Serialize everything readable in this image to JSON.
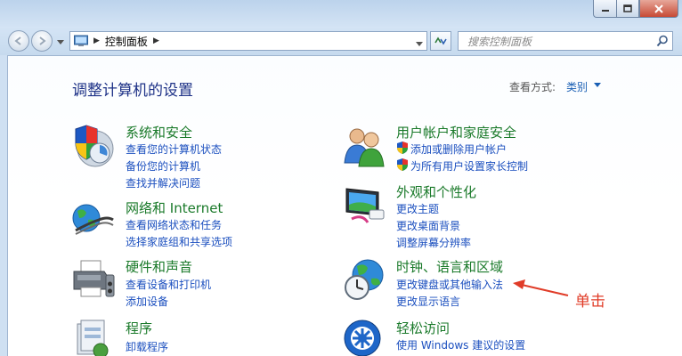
{
  "address_bar": {
    "path": "控制面板"
  },
  "search": {
    "placeholder": "搜索控制面板"
  },
  "main": {
    "heading": "调整计算机的设置",
    "view_by_label": "查看方式:",
    "view_by_value": "类别"
  },
  "categories": {
    "system_security": {
      "title": "系统和安全",
      "links": [
        "查看您的计算机状态",
        "备份您的计算机",
        "查找并解决问题"
      ]
    },
    "user_accounts": {
      "title": "用户帐户和家庭安全",
      "links": [
        "添加或删除用户帐户",
        "为所有用户设置家长控制"
      ]
    },
    "network": {
      "title": "网络和 Internet",
      "links": [
        "查看网络状态和任务",
        "选择家庭组和共享选项"
      ]
    },
    "appearance": {
      "title": "外观和个性化",
      "links": [
        "更改主题",
        "更改桌面背景",
        "调整屏幕分辨率"
      ]
    },
    "hardware": {
      "title": "硬件和声音",
      "links": [
        "查看设备和打印机",
        "添加设备"
      ]
    },
    "clock_region": {
      "title": "时钟、语言和区域",
      "links": [
        "更改键盘或其他输入法",
        "更改显示语言"
      ]
    },
    "programs": {
      "title": "程序",
      "links": [
        "卸载程序"
      ]
    },
    "ease_access": {
      "title": "轻松访问",
      "links": [
        "使用 Windows 建议的设置"
      ]
    }
  },
  "annotation": {
    "text": "单击",
    "color": "#e03c28"
  },
  "colors": {
    "heading": "#1e3287",
    "category_title": "#1a7a2a",
    "link": "#1b4fbf"
  }
}
